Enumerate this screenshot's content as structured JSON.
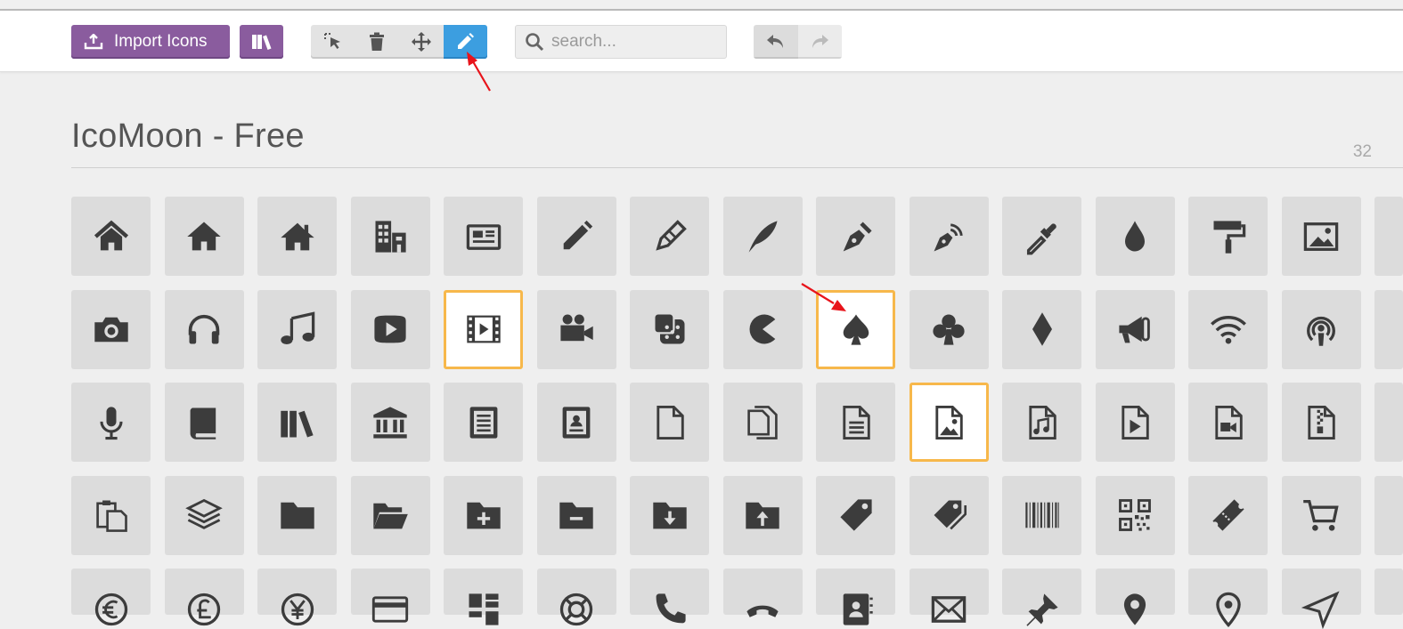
{
  "toolbar": {
    "import_label": "Import Icons",
    "search_placeholder": "search...",
    "icons": {
      "import": "import-icon",
      "library": "library-icon",
      "select": "cursor-icon",
      "delete": "trash-icon",
      "move": "move-icon",
      "edit": "pencil-icon",
      "search": "search-icon",
      "undo": "undo-icon",
      "redo": "redo-icon"
    },
    "active_tool": "edit",
    "colors": {
      "primary": "#8a5c9e",
      "active_tool": "#3c9ee0",
      "selection_border": "#f7b84b",
      "annotation_arrow": "#e8141b"
    }
  },
  "icon_set": {
    "title": "IcoMoon - Free",
    "count": "32",
    "rows": [
      [
        "home-icon",
        "home2-icon",
        "home3-icon",
        "office-icon",
        "newspaper-icon",
        "pencil-icon",
        "pencil2-icon",
        "quill-icon",
        "pen-icon",
        "blog-icon",
        "eyedropper-icon",
        "droplet-icon",
        "paint-format-icon",
        "image-icon",
        "images-icon"
      ],
      [
        "camera-icon",
        "headphones-icon",
        "music-icon",
        "play-icon",
        "film-icon",
        "video-camera-icon",
        "dice-icon",
        "pacman-icon",
        "spades-icon",
        "clubs-icon",
        "diamonds-icon",
        "bullhorn-icon",
        "connection-icon",
        "podcast-icon",
        "feed-icon"
      ],
      [
        "mic-icon",
        "book-icon",
        "books-icon",
        "library-icon",
        "file-text-icon",
        "profile-icon",
        "file-empty-icon",
        "files-empty-icon",
        "file-text2-icon",
        "file-picture-icon",
        "file-music-icon",
        "file-play-icon",
        "file-video-icon",
        "file-zip-icon",
        "copy-icon"
      ],
      [
        "paste-icon",
        "stack-icon",
        "folder-icon",
        "folder-open-icon",
        "folder-plus-icon",
        "folder-minus-icon",
        "folder-download-icon",
        "folder-upload-icon",
        "price-tag-icon",
        "price-tags-icon",
        "barcode-icon",
        "qrcode-icon",
        "ticket-icon",
        "cart-icon",
        "coin-dollar-icon"
      ],
      [
        "coin-euro-icon",
        "coin-pound-icon",
        "coin-yen-icon",
        "credit-card-icon",
        "calculator-icon",
        "lifebuoy-icon",
        "phone-icon",
        "phone-hang-up-icon",
        "address-book-icon",
        "envelop-icon",
        "pushpin-icon",
        "location-icon",
        "location2-icon",
        "compass-icon",
        "compass2-icon"
      ]
    ],
    "selected": [
      "film-icon",
      "spades-icon",
      "file-picture-icon"
    ]
  }
}
